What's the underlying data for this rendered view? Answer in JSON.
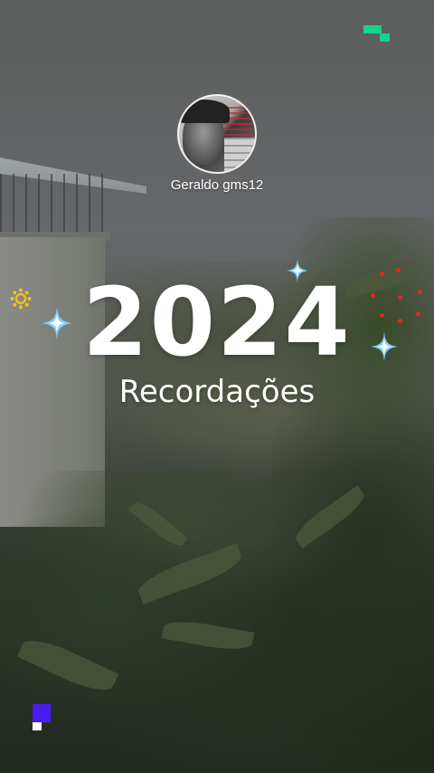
{
  "story": {
    "username": "Geraldo gms12",
    "year": "2024",
    "subtitle": "Recordações"
  },
  "icons": {
    "brand": "brand-mark-icon",
    "avatar": "profile-avatar",
    "sparkles": "sparkle-icon",
    "sun": "sun-icon",
    "corner": "corner-mark-icon"
  },
  "colors": {
    "text": "#ffffff",
    "brand_green": "#14d48e",
    "sparkle_blue": "#7fd0ff",
    "sun_yellow": "#f2c21a",
    "corner_purple": "#4a1cf2"
  }
}
